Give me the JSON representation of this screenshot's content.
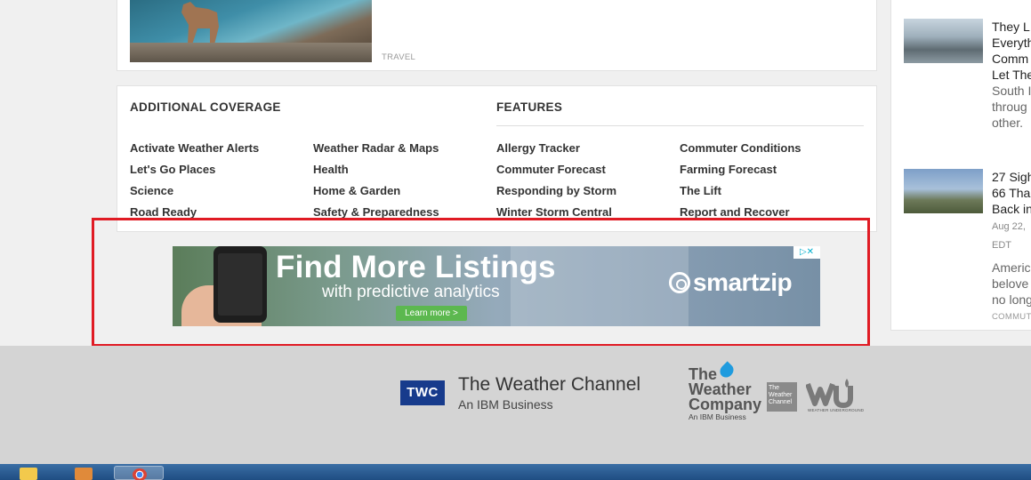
{
  "top_story": {
    "tag": "TRAVEL"
  },
  "additional_coverage": {
    "heading": "ADDITIONAL COVERAGE",
    "col1": [
      "Activate Weather Alerts",
      "Let's Go Places",
      "Science",
      "Road Ready"
    ],
    "col2": [
      "Weather Radar & Maps",
      "Health",
      "Home & Garden",
      "Safety & Preparedness"
    ]
  },
  "features": {
    "heading": "FEATURES",
    "col1": [
      "Allergy Tracker",
      "Commuter Forecast",
      "Responding by Storm",
      "Winter Storm Central"
    ],
    "col2": [
      "Commuter Conditions",
      "Farming Forecast",
      "The Lift",
      "Report and Recover"
    ]
  },
  "ad": {
    "headline": "Find More Listings",
    "subline": "with predictive analytics",
    "cta": "Learn more >",
    "brand": "smartzip",
    "choices_glyph": "▷✕"
  },
  "footer": {
    "badge": "TWC",
    "title": "The Weather Channel",
    "subtitle": "An IBM Business",
    "company_line1": "The",
    "company_line2": "Weather",
    "company_line3": "Company",
    "company_small": "An IBM Business",
    "channel_logo_text": "The Weather Channel",
    "wu_text": "WEATHER UNDERGROUND"
  },
  "rail": {
    "story1": {
      "title_lines": [
        "They L",
        "Everyth",
        "Comm",
        "Let The"
      ],
      "text_lines": [
        "South I",
        "throug",
        "other."
      ]
    },
    "story2": {
      "title_lines": [
        "27 Sigh",
        "66 Tha",
        "Back in"
      ],
      "date_lines": [
        "Aug 22,",
        "EDT"
      ],
      "text_lines": [
        "Americ",
        "belove",
        "no long"
      ],
      "tag": "COMMUT"
    }
  },
  "colors": {
    "highlight_outline": "#e01b24",
    "twc_blue": "#173b8c",
    "cta_green": "#5cb84f"
  }
}
